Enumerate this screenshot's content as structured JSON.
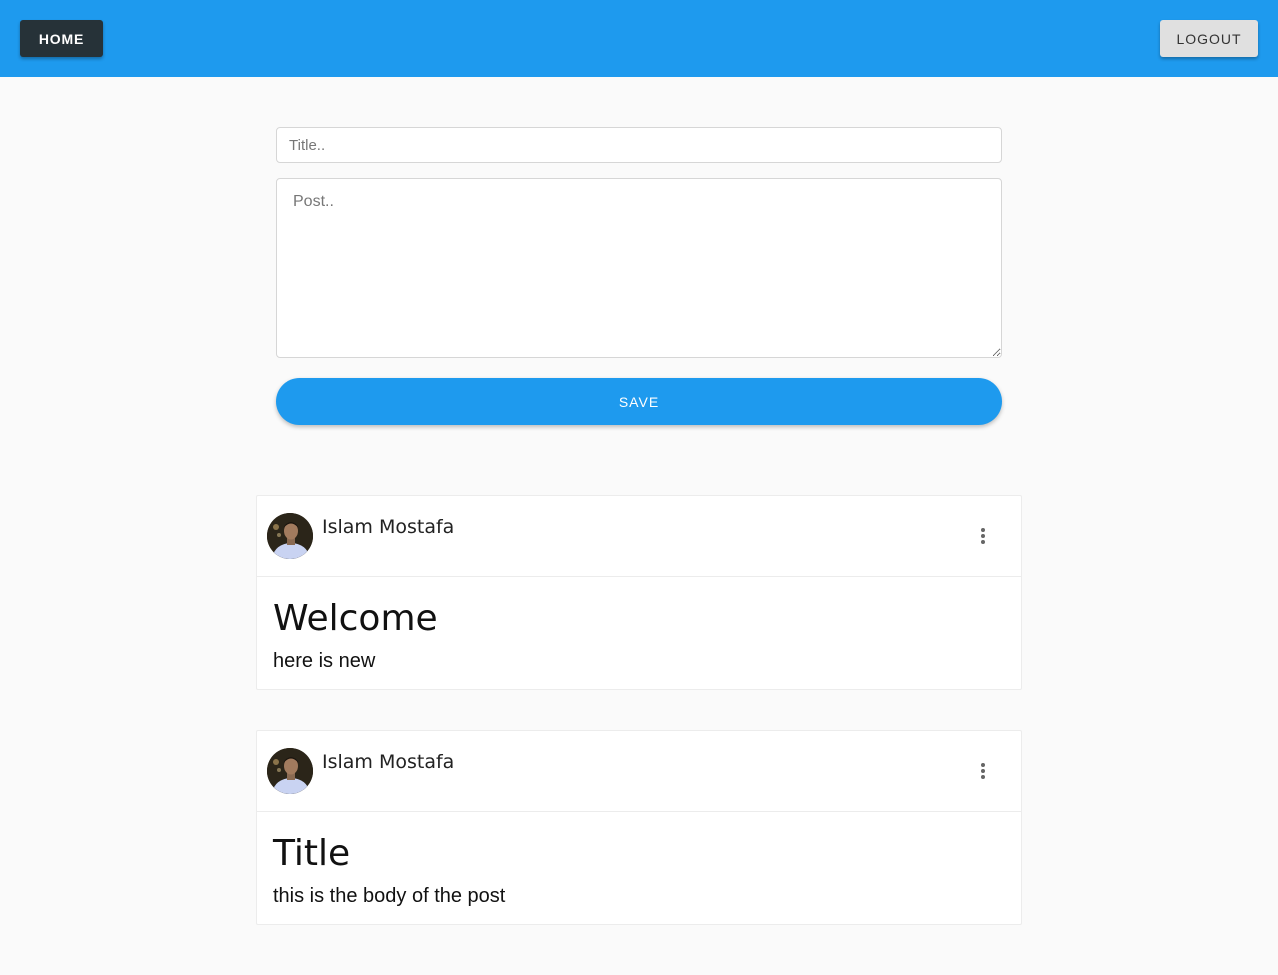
{
  "header": {
    "home_label": "HOME",
    "logout_label": "LOGOUT",
    "bar_color": "#1e9aee"
  },
  "composer": {
    "title_placeholder": "Title..",
    "title_value": "",
    "post_placeholder": "Post..",
    "post_value": "",
    "save_label": "SAVE"
  },
  "posts": [
    {
      "author": "Islam Mostafa",
      "avatar_icon": "user-avatar-photo",
      "menu_icon": "more-vertical-icon",
      "title": "Welcome",
      "body": "here is new"
    },
    {
      "author": "Islam Mostafa",
      "avatar_icon": "user-avatar-photo",
      "menu_icon": "more-vertical-icon",
      "title": "Title",
      "body": "this is the body of the post"
    }
  ]
}
